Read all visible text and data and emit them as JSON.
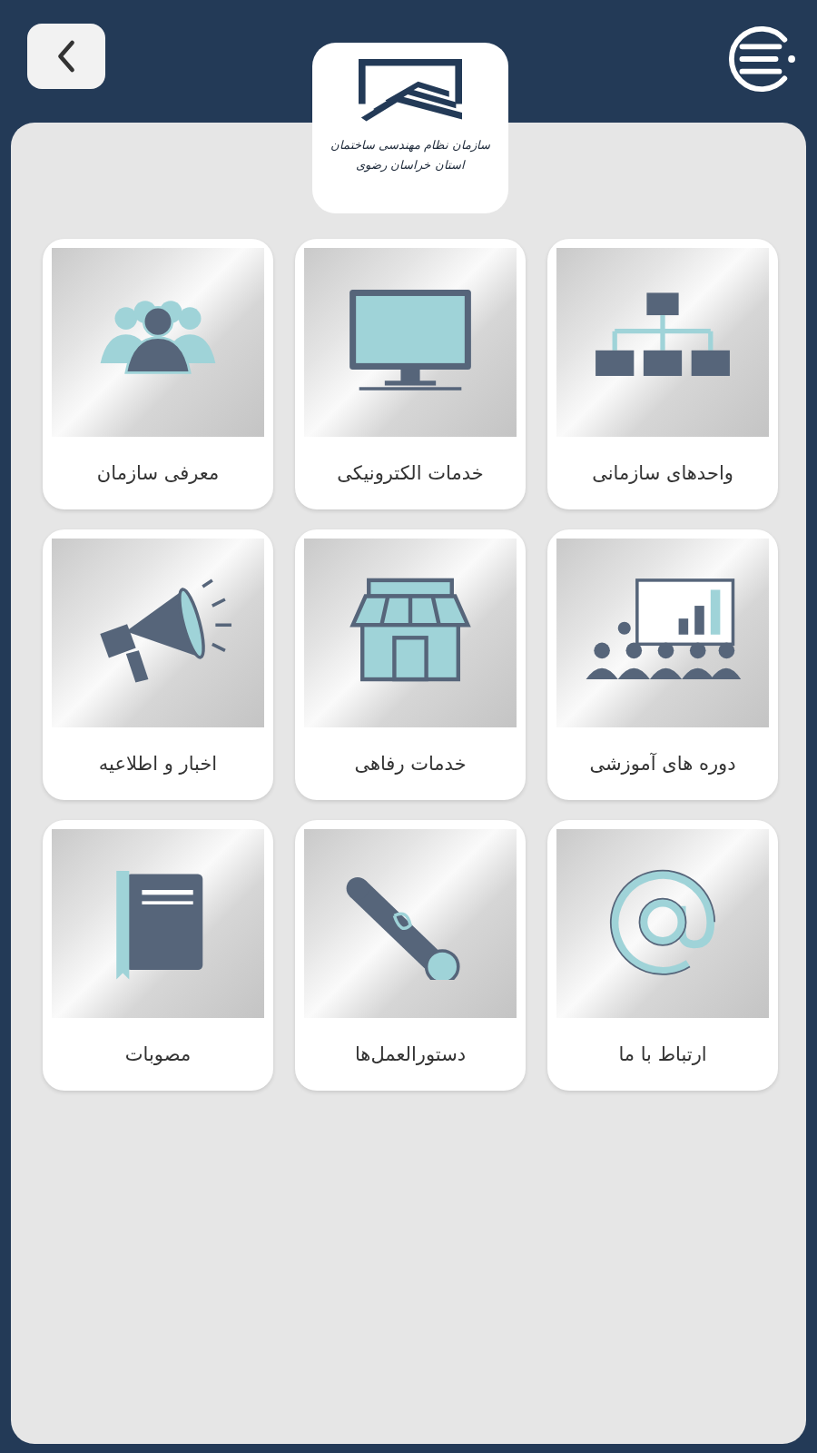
{
  "header": {
    "logo": {
      "lines": [
        "سازمان نظام مهندسی ساختمان",
        "استان خراسان رضوی"
      ]
    }
  },
  "tiles": [
    {
      "label": "واحدهای سازمانی",
      "kind": "org-chart"
    },
    {
      "label": "خدمات الکترونیکی",
      "kind": "monitor"
    },
    {
      "label": "معرفی سازمان",
      "kind": "people"
    },
    {
      "label": "دوره های آموزشی",
      "kind": "classroom"
    },
    {
      "label": "خدمات رفاهی",
      "kind": "shop"
    },
    {
      "label": "اخبار و اطلاعیه",
      "kind": "megaphone"
    },
    {
      "label": "ارتباط با ما",
      "kind": "at"
    },
    {
      "label": "دستورالعمل‌ها",
      "kind": "scroll"
    },
    {
      "label": "مصوبات",
      "kind": "book"
    }
  ]
}
